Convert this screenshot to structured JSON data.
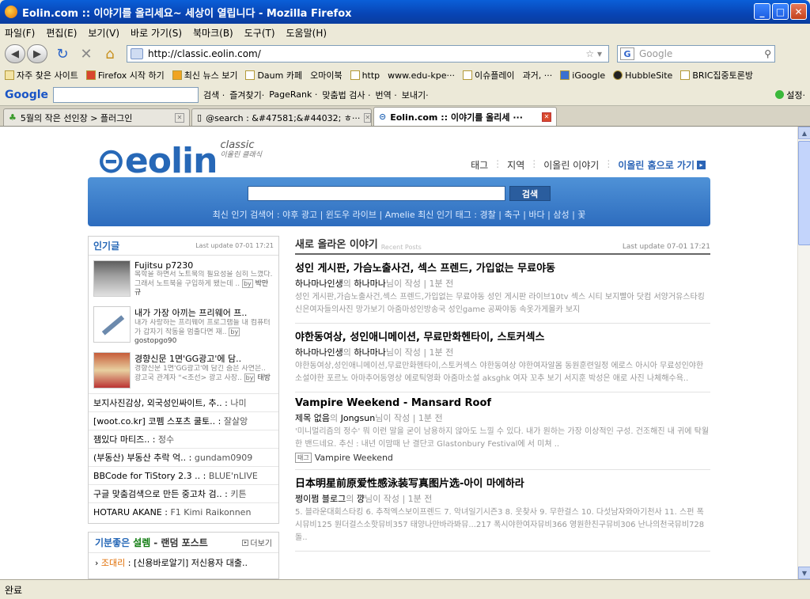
{
  "window": {
    "title": "Eolin.com :: 이야기를 올리세요~ 세상이 열립니다 - Mozilla Firefox"
  },
  "menu": [
    "파일(F)",
    "편집(E)",
    "보기(V)",
    "바로 가기(S)",
    "북마크(B)",
    "도구(T)",
    "도움말(H)"
  ],
  "nav": {
    "url": "http://classic.eolin.com/",
    "search_placeholder": "Google"
  },
  "bookmarks": [
    "자주 찾은 사이트",
    "Firefox 시작 하기",
    "최신 뉴스 보기",
    "Daum 카페",
    "오마이북",
    "http",
    "www.edu-kpe···",
    "이슈플레이",
    "과거, ···",
    "iGoogle",
    "HubbleSite",
    "BRIC집중토론방"
  ],
  "gtoolbar": {
    "logo": "Google",
    "items": [
      "검색 ·",
      "즐겨찾기·",
      "PageRank ·",
      "맞춤법 검사 ·",
      "번역 ·",
      "보내기·"
    ],
    "settings": "설정·"
  },
  "tabs": [
    {
      "label": "5월의 작은 선인장 > 플러그인"
    },
    {
      "label": "@search : &#47581;&#44032; ㅎ···"
    },
    {
      "label": "Eolin.com :: 이야기를 올리세 ···"
    }
  ],
  "status": "완료",
  "page": {
    "logo": {
      "main": "eolin",
      "sub": "classic",
      "sub2": "이올린 클래식"
    },
    "topnav": [
      "태그",
      "지역",
      "이올린 이야기",
      "이올린 홈으로 가기"
    ],
    "search_button": "검색",
    "popular": "최신 인기 검색어 : 야후 광고 | 윈도우 라이브 | Amelie      최신 인기 태그 : 경찰 | 축구 | 바다 | 삼성 | 꽃",
    "left": {
      "title": "인기글",
      "update": "Last update 07-01 17:21",
      "featured": [
        {
          "title": "Fujitsu p7230",
          "desc": "복학을 하면서 노트북의 필요성을 심히 느꼈다. 그래서 노트북을 구입하게 됐는데 ..",
          "by": "by",
          "user": "박만규"
        },
        {
          "title": "내가 가장 아끼는 프리웨어 프..",
          "desc": "내가 사랑하는 프리웨어 프로그램들 내 컴퓨터가 갑자기 작동을 멈출다면 재..",
          "by": "by",
          "user": "gostopgo90"
        },
        {
          "title": "경향신문 1면'GG광고'에 담..",
          "desc": "경향신문 1면'GG광고'에 담긴 숨은 사연은.. 광고국 관계자 \"<조선> 광고 사장..",
          "by": "by",
          "user": "태방"
        }
      ],
      "list": [
        {
          "t": "보지사진감상, 외국성인싸이트, 추..",
          "u": "나미"
        },
        {
          "t": "[woot.co.kr] 코펨 스포츠 쿨토..",
          "u": "잘살앙"
        },
        {
          "t": "잼있다 마티즈..",
          "u": "정수"
        },
        {
          "t": "(부동산) 부동산 추락 억..",
          "u": "gundam0909"
        },
        {
          "t": "BBCode for TiStory 2.3 ..",
          "u": "BLUE'nLIVE"
        },
        {
          "t": "구글 맞춤검색으로 만든 중고차 검..",
          "u": "키튼"
        },
        {
          "t": "HOTARU AKANE",
          "u": "F1 Kimi Raikonnen"
        }
      ]
    },
    "left2": {
      "a": "기분좋은",
      "b": "설렘",
      "c": "- 랜덤 포스트",
      "more": "더보기",
      "item_cat": "조대리",
      "item": ": [신용바로알기] 저신용자 대출.."
    },
    "main": {
      "title": "새로 올라온 이야기",
      "title_en": "Recent Posts",
      "update": "Last update 07-01 17:21",
      "posts": [
        {
          "title": "성인 게시판, 가슴노출사건, 섹스 프렌드, 가입없는 무료야동",
          "a1": "하나마나인생",
          "a2": "하나마나",
          "time": "님이 작성 | 1분 전",
          "body": "성인 게시판,가슴노출사건,섹스 프렌드,가입없는 무료야동 성인 게시판 라이브10tv 섹스 시티 보지빨아 닷컴 서양거유스타킹신은여자들의사진 망가보기 아줌마성인방송국 성인game 공짜야동 속옷가게몰카 보지",
          "tag": ""
        },
        {
          "title": "야한동여상, 성인애니메이션, 무료만화헨타이, 스토커섹스",
          "a1": "하나마나인생",
          "a2": "하나마나",
          "time": "님이 작성 | 1분 전",
          "body": "야한동여상,성인애니메이션,무료만화헨타이,스토커섹스 야한동여상 야한여자알몸 동원훈련일정 에로스 아시아 무료성인야한소설야한 포르노 아마추어동영상 에로틱영화 아줌마소설 aksghk 여자 꼬추 보기 서지훈 박성은 애로 사진 나체해수욕..",
          "tag": ""
        },
        {
          "title": "Vampire Weekend - Mansard Roof",
          "a1": "제목 없음",
          "a2": "Jongsun",
          "time": "님이 작성 | 1분 전",
          "body": "'미니멀리즘의 정수' 뭐 이런 말을 굳이 남용하지 않아도 느낄 수 있다.   내가 원하는 가장 이상적인 구성.   건조해진 내 귀에 탁월한 밴드네요.   추신 : 내년 이맘때 난 결단코 Glastonbury Festival에 서 미쳐 ..",
          "tag": "Vampire Weekend"
        },
        {
          "title": "日本明星前原爱性感泳装写真图片选-아이 마에하라",
          "a1": "쩡이쩜 블로그",
          "a2": "꺙",
          "time": "님이 작성 | 1분 전",
          "body": "5. 블라운대회스타킹 6. 추적엑스보이프렌드 7. 악녀일기시즌3 8. 웃찾사 9. 무한걸스 10. 다섯남자와아기천사 11. 스펀 폭시뮤비125 원더걸스소핫뮤비357 태양나만바라봐뮤...217 폭시야한여자뮤비366 영원한친구뮤비306 난나의천국뮤비728 돌..",
          "tag": ""
        }
      ]
    }
  }
}
